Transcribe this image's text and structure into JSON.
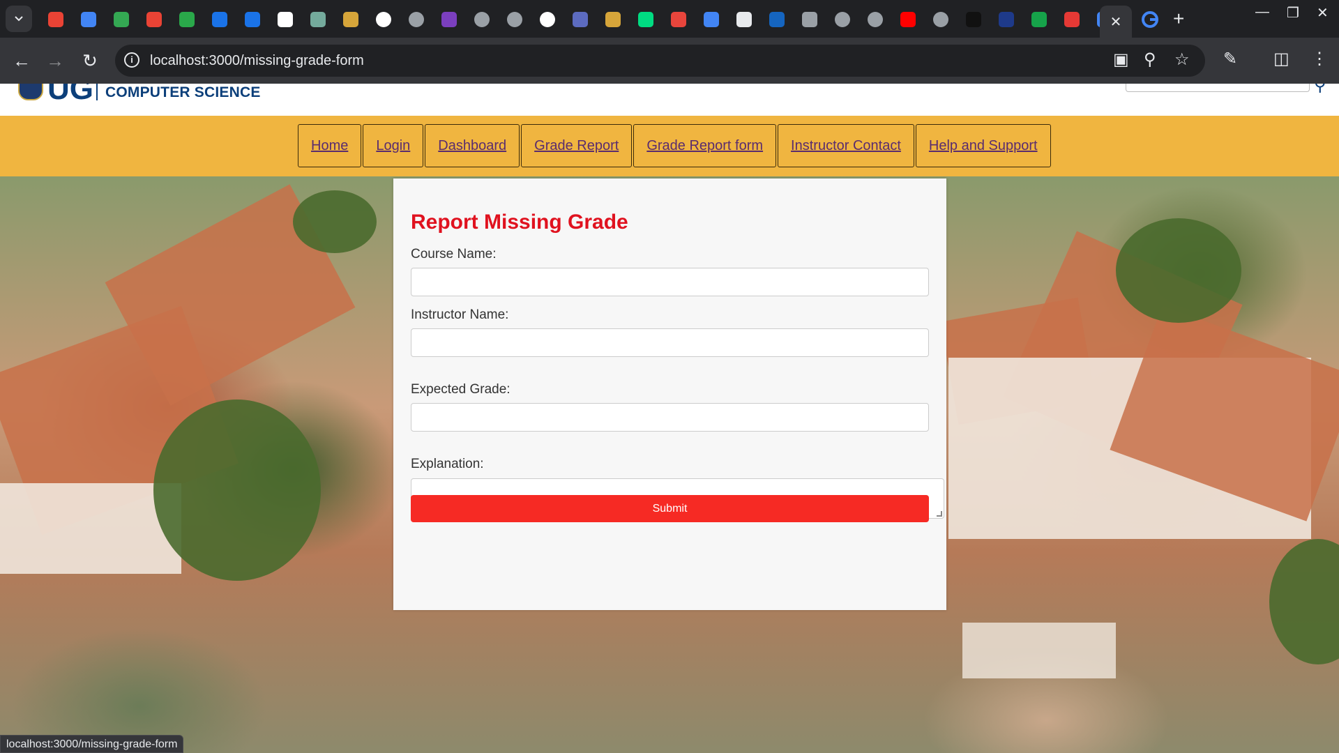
{
  "browser": {
    "url": "localhost:3000/missing-grade-form",
    "status_url": "localhost:3000/missing-grade-form",
    "active_tab_close": "✕",
    "new_tab": "+",
    "favicons": [
      {
        "name": "gmail-icon",
        "color": "#ea4335"
      },
      {
        "name": "docs-icon",
        "color": "#4285f4"
      },
      {
        "name": "play-icon",
        "color": "#34a853"
      },
      {
        "name": "gmail-icon",
        "color": "#ea4335"
      },
      {
        "name": "app-icon",
        "color": "#2aa84a"
      },
      {
        "name": "circle-icon",
        "color": "#1a73e8"
      },
      {
        "name": "circle-icon",
        "color": "#1a73e8"
      },
      {
        "name": "github-icon",
        "color": "#ffffff"
      },
      {
        "name": "chatgpt-icon",
        "color": "#74aa9c"
      },
      {
        "name": "folder-icon",
        "color": "#d6a53a"
      },
      {
        "name": "google-icon",
        "color": "#ffffff"
      },
      {
        "name": "globe-icon",
        "color": "#9aa0a6"
      },
      {
        "name": "p-icon",
        "color": "#7b3fbf"
      },
      {
        "name": "globe-icon",
        "color": "#9aa0a6"
      },
      {
        "name": "globe-icon",
        "color": "#9aa0a6"
      },
      {
        "name": "google-icon",
        "color": "#ffffff"
      },
      {
        "name": "p-icon",
        "color": "#5c6bc0"
      },
      {
        "name": "folder-icon",
        "color": "#d6a53a"
      },
      {
        "name": "nuxt-icon",
        "color": "#00dc82"
      },
      {
        "name": "red-icon",
        "color": "#e8453c"
      },
      {
        "name": "docs-icon",
        "color": "#4285f4"
      },
      {
        "name": "qr-icon",
        "color": "#e8eaed"
      },
      {
        "name": "tt-icon",
        "color": "#1565c0"
      },
      {
        "name": "apple-icon",
        "color": "#9aa0a6"
      },
      {
        "name": "globe-icon",
        "color": "#9aa0a6"
      },
      {
        "name": "globe-icon",
        "color": "#9aa0a6"
      },
      {
        "name": "youtube-icon",
        "color": "#ff0000"
      },
      {
        "name": "globe-icon",
        "color": "#9aa0a6"
      },
      {
        "name": "app-icon",
        "color": "#111111"
      },
      {
        "name": "n-icon",
        "color": "#1e3a8a"
      },
      {
        "name": "app-icon",
        "color": "#16a34a"
      },
      {
        "name": "gear-icon",
        "color": "#e53935"
      },
      {
        "name": "docs-icon",
        "color": "#4285f4"
      }
    ]
  },
  "site": {
    "logo_letters": "UG",
    "logo_department": "COMPUTER SCIENCE",
    "nav": [
      {
        "label": "Home"
      },
      {
        "label": "Login"
      },
      {
        "label": "Dashboard"
      },
      {
        "label": "Grade Report"
      },
      {
        "label": "Grade Report form"
      },
      {
        "label": "Instructor Contact"
      },
      {
        "label": "Help and Support"
      }
    ]
  },
  "form": {
    "title": "Report Missing Grade",
    "course_label": "Course Name:",
    "course_value": "",
    "instructor_label": "Instructor Name:",
    "instructor_value": "",
    "grade_label": "Expected Grade:",
    "grade_value": "",
    "explanation_label": "Explanation:",
    "explanation_value": "",
    "submit_label": "Submit"
  },
  "colors": {
    "navbar": "#f0b540",
    "title": "#e0121f",
    "submit": "#f62a24",
    "brand_blue": "#0c3f7a"
  }
}
